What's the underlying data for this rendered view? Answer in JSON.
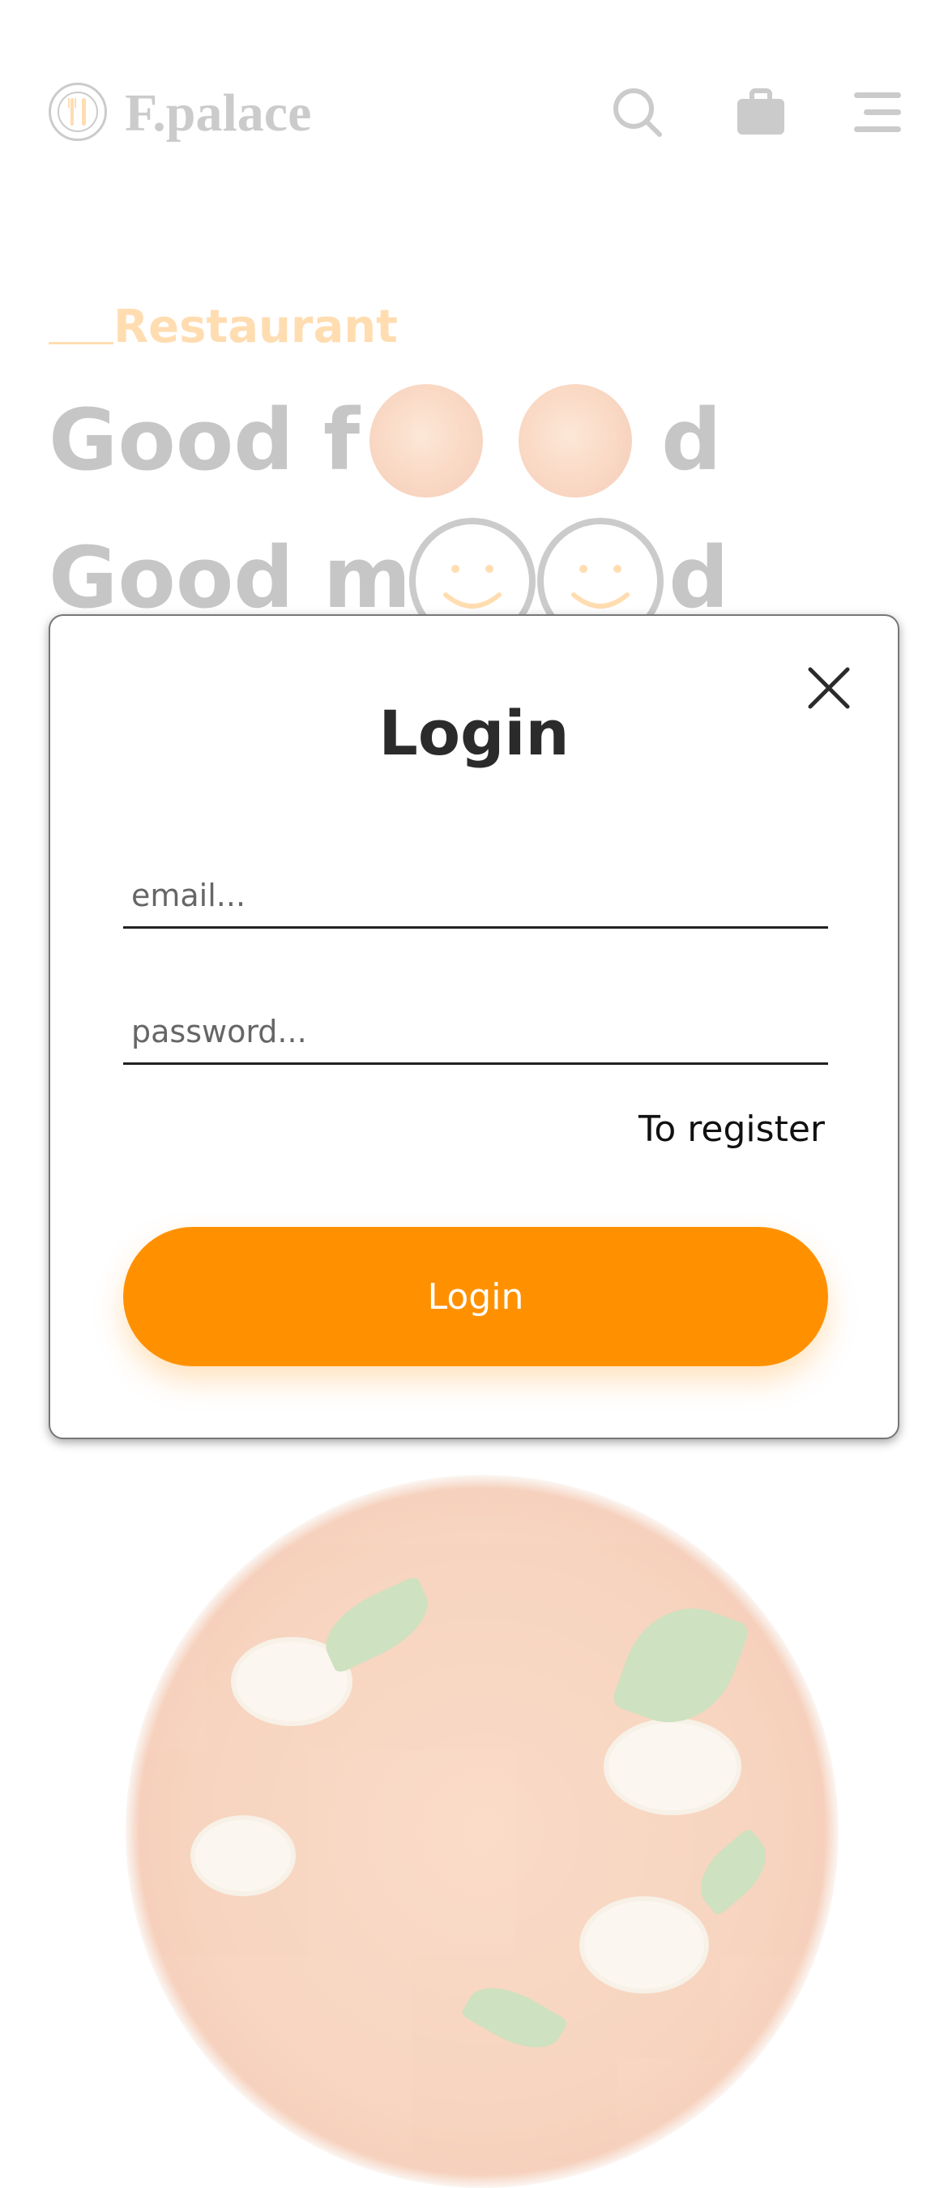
{
  "header": {
    "logo_text": "F.palace",
    "icons": [
      "utensils-logo-icon",
      "search-icon",
      "shopping-bag-icon",
      "menu-icon"
    ]
  },
  "hero": {
    "label": "Restaurant",
    "title_line1": {
      "before": "Good f",
      "after": "d"
    },
    "title_line2": {
      "before": "Good m",
      "after": "d"
    }
  },
  "modal": {
    "title": "Login",
    "email_placeholder": "email...",
    "password_placeholder": "password...",
    "register_link": "To register",
    "login_button": "Login"
  },
  "colors": {
    "accent": "#ff9100",
    "text_dark": "#2b2b2b",
    "title_gray": "#444444"
  }
}
